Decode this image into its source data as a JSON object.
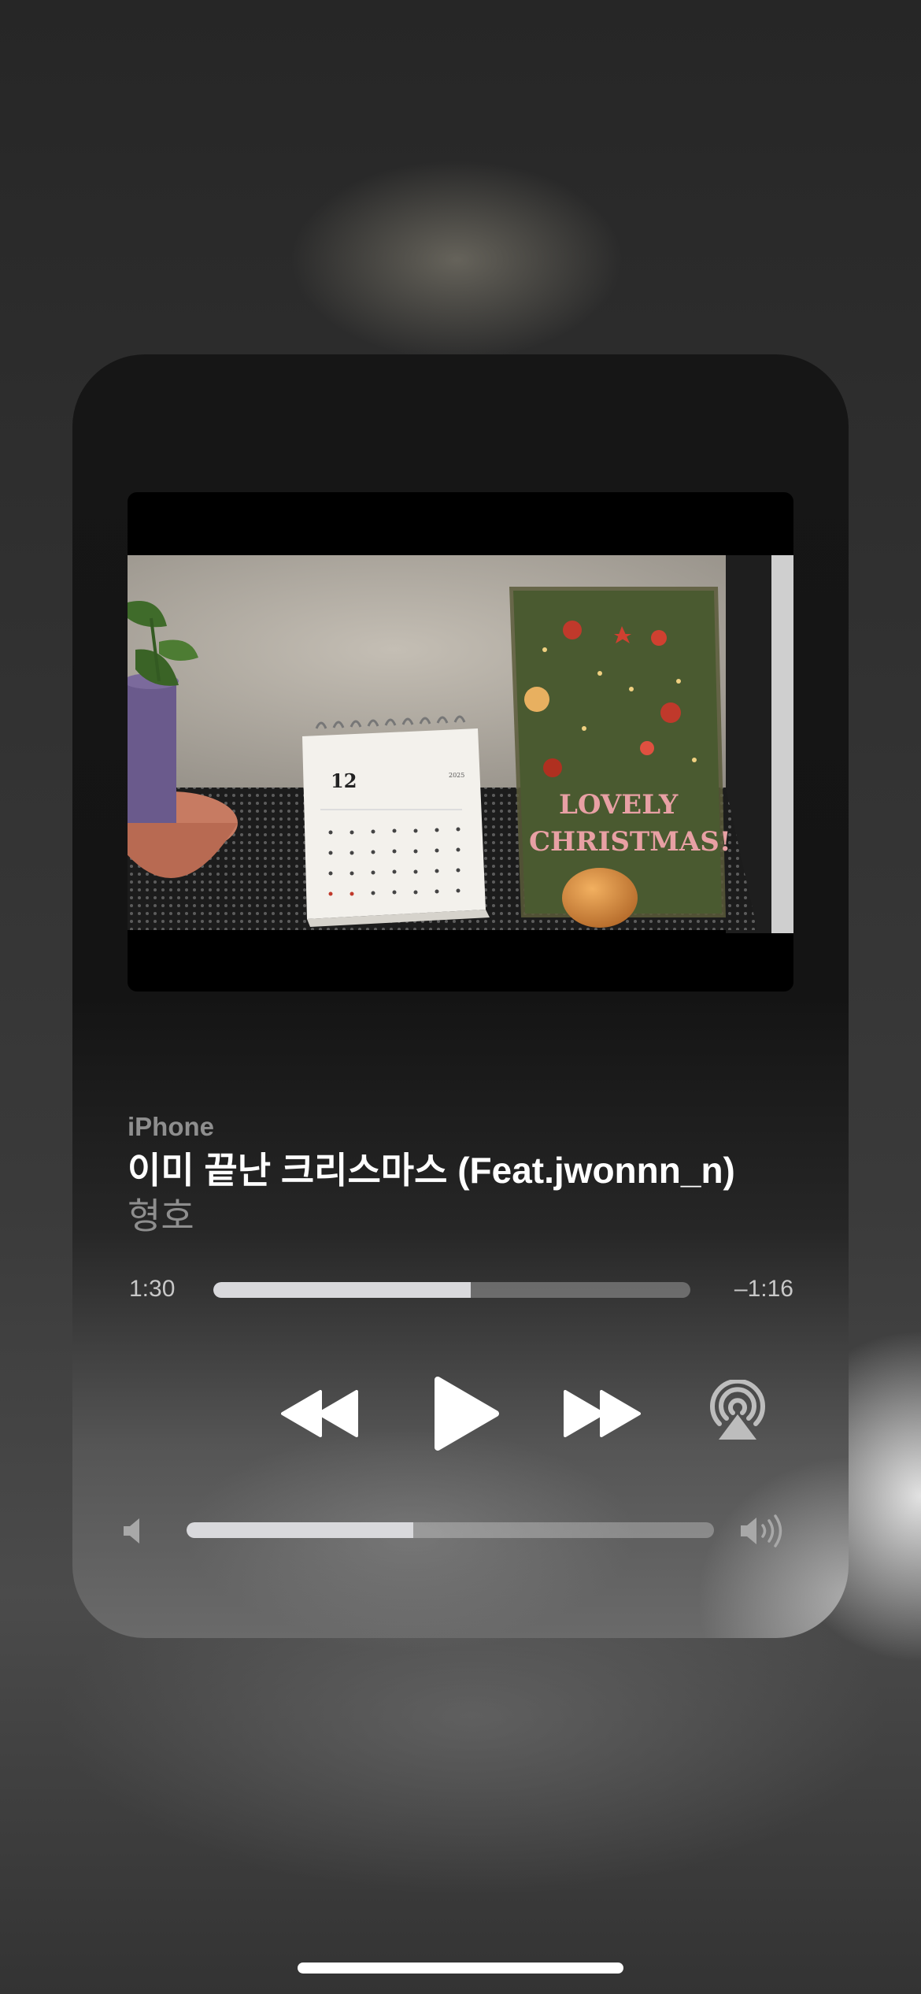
{
  "now_playing": {
    "source": "iPhone",
    "title": "이미 끝난 크리스마스 (Feat.jwonnn_n)",
    "artist": "형호",
    "elapsed": "1:30",
    "remaining": "–1:16",
    "progress_fraction": 0.54
  },
  "video": {
    "calendar_month": "12",
    "calendar_year": "2025",
    "card_text_line1": "LOVELY",
    "card_text_line2": "CHRISTMAS!"
  },
  "controls": {
    "rewind_icon": "rewind-icon",
    "play_icon": "play-icon",
    "forward_icon": "fast-forward-icon",
    "airplay_icon": "airplay-audio-icon"
  },
  "volume": {
    "level_fraction": 0.43,
    "low_icon": "speaker-low-icon",
    "high_icon": "speaker-high-icon"
  },
  "colors": {
    "accent_fill": "#d9d9dc",
    "secondary_text": "#8e8e8e"
  }
}
